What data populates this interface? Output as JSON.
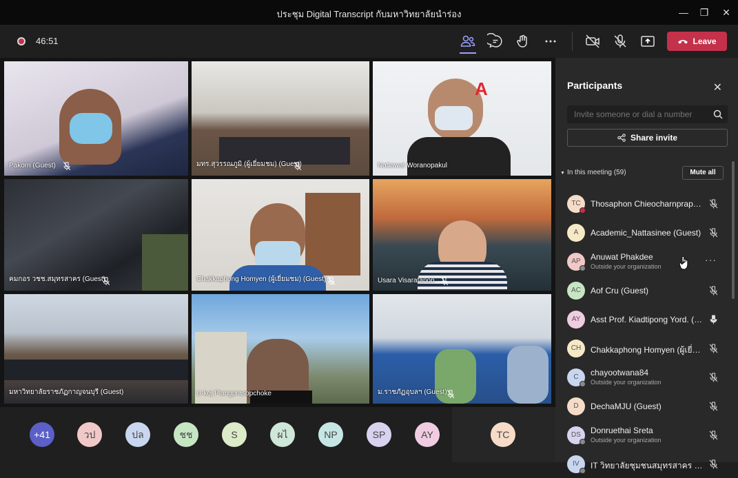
{
  "window": {
    "title": "ประชุม Digital Transcript กับมหาวิทยาลัยนำร่อง",
    "controls": [
      "minimize",
      "maximize",
      "close"
    ]
  },
  "toolbar": {
    "timer": "46:51",
    "leave_label": "Leave",
    "icons": [
      "participants-icon",
      "chat-icon",
      "reactions-icon",
      "more-icon",
      "camera-off-icon",
      "mic-off-icon",
      "share-tray-icon"
    ]
  },
  "video_tiles": [
    {
      "name": "Pakorn (Guest)"
    },
    {
      "name": "มทร.สุวรรณภูมิ (ผู้เยี่ยมชม) (Guest)"
    },
    {
      "name": "Nattawat Woranopakul"
    },
    {
      "name": "คมกอร วชช.สมุทรสาคร (Guest)"
    },
    {
      "name": "Chakkaphong Homyen (ผู้เยี่ยมชม) (Guest)"
    },
    {
      "name": "Usara Visaratanon"
    },
    {
      "name": "มหาวิทยาลัยราชภัฏกาญจนบุรี (Guest)"
    },
    {
      "name": "U-koj Plangprasopchoke"
    },
    {
      "name": "ม.ราชภัฏอุบลฯ (Guest)"
    }
  ],
  "avatar_strip": [
    {
      "label": "+41",
      "color": "#5b5fc7"
    },
    {
      "label": "วป",
      "color": "#f1c8c8"
    },
    {
      "label": "ปล",
      "color": "#c8d6ef"
    },
    {
      "label": "ชช",
      "color": "#c6e6c3"
    },
    {
      "label": "S",
      "color": "#dcebc8"
    },
    {
      "label": "ผไ",
      "color": "#cfe7d8"
    },
    {
      "label": "NP",
      "color": "#c6e6e6"
    },
    {
      "label": "SP",
      "color": "#d9d2ef"
    },
    {
      "label": "AY",
      "color": "#f0cce2"
    },
    {
      "label": "TC",
      "color": "#f6dcc8"
    }
  ],
  "participants_panel": {
    "title": "Participants",
    "invite_placeholder": "Invite someone or dial a number",
    "share_invite_label": "Share invite",
    "section_label": "In this meeting (59)",
    "mute_all_label": "Mute all",
    "participants": [
      {
        "initials": "TC",
        "name": "Thosaphon Chieocharnpraphan",
        "subtitle": "",
        "color": "#f6dcc8",
        "mic": "muted",
        "status": "#c4314b"
      },
      {
        "initials": "A",
        "name": "Academic_Nattasinee (Guest)",
        "subtitle": "",
        "color": "#f6e9c6",
        "mic": "muted",
        "status": ""
      },
      {
        "initials": "AP",
        "name": "Anuwat Phakdee",
        "subtitle": "Outside your organization",
        "color": "#f1c8c8",
        "mic": "more",
        "status": "#8a8a8a"
      },
      {
        "initials": "AC",
        "name": "Aof Cru (Guest)",
        "subtitle": "",
        "color": "#c6e6c3",
        "mic": "muted",
        "status": ""
      },
      {
        "initials": "AY",
        "name": "Asst Prof. Kiadtipong Yord. (G...",
        "subtitle": "",
        "color": "#f0cce2",
        "mic": "on",
        "status": ""
      },
      {
        "initials": "CH",
        "name": "Chakkaphong Homyen (ผู้เยี่ยม...",
        "subtitle": "",
        "color": "#f6e9c6",
        "mic": "muted",
        "status": ""
      },
      {
        "initials": "C",
        "name": "chayootwana84",
        "subtitle": "Outside your organization",
        "color": "#c8d6ef",
        "mic": "muted",
        "status": "#8a8a8a"
      },
      {
        "initials": "D",
        "name": "DechaMJU (Guest)",
        "subtitle": "",
        "color": "#f6dcc8",
        "mic": "muted",
        "status": ""
      },
      {
        "initials": "DS",
        "name": "Donruethai Sreta",
        "subtitle": "Outside your organization",
        "color": "#d9d2ef",
        "mic": "muted",
        "status": "#8a8a8a"
      },
      {
        "initials": "IV",
        "name": "IT วิทยาลัยชุมชนสมุทรสาคร (Gue...",
        "subtitle": "",
        "color": "#c8d6ef",
        "mic": "muted",
        "status": "#8a8a8a"
      }
    ]
  }
}
